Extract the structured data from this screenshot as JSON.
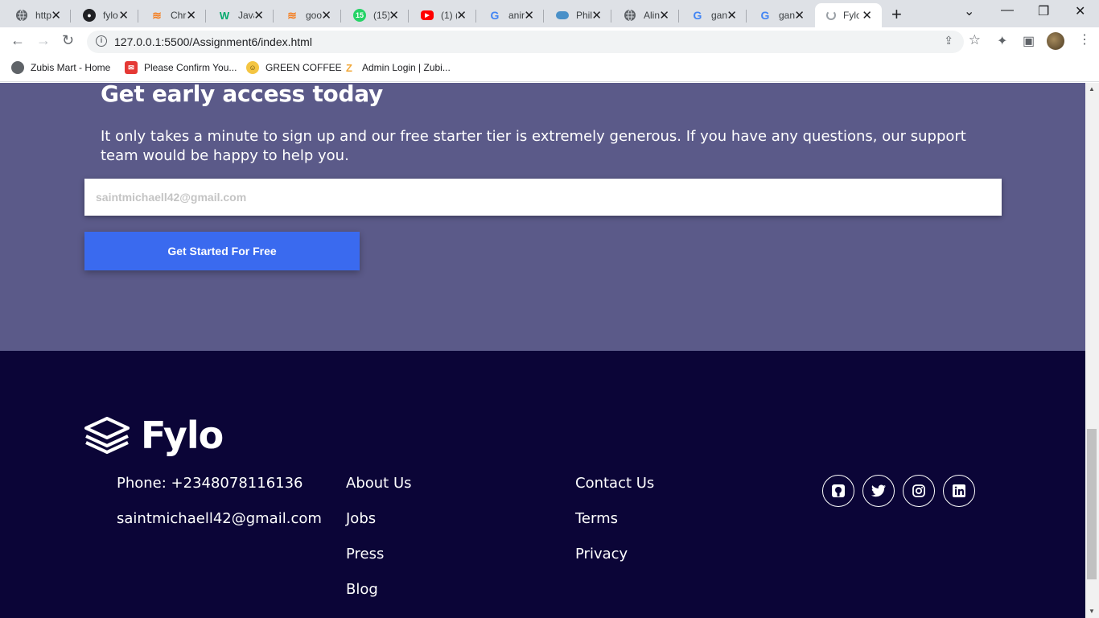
{
  "browser": {
    "tabs": [
      {
        "title": "http",
        "icon": "globe-icon",
        "color": "#5f6368"
      },
      {
        "title": "fylo",
        "icon": "github-icon",
        "color": "#202124"
      },
      {
        "title": "Chr",
        "icon": "stackoverflow-icon",
        "color": "#f48024"
      },
      {
        "title": "Java",
        "icon": "w3schools-icon",
        "color": "#04aa6d"
      },
      {
        "title": "goo",
        "icon": "stackoverflow-icon",
        "color": "#f48024"
      },
      {
        "title": "(15)",
        "icon": "whatsapp-icon",
        "color": "#25d366",
        "badge": "15"
      },
      {
        "title": "(1) (",
        "icon": "youtube-icon",
        "color": "#ff0000"
      },
      {
        "title": "anir",
        "icon": "google-icon",
        "color": "#4285f4"
      },
      {
        "title": "Phil",
        "icon": "cloud-icon",
        "color": "#4a90c8"
      },
      {
        "title": "Alin",
        "icon": "globe-icon",
        "color": "#5f6368"
      },
      {
        "title": "gan",
        "icon": "google-icon",
        "color": "#4285f4"
      },
      {
        "title": "gan",
        "icon": "google-icon",
        "color": "#4285f4"
      },
      {
        "title": "Fylo",
        "icon": "loading-icon",
        "color": "#9aa0a6",
        "active": true
      }
    ],
    "url": "127.0.0.1:5500/Assignment6/index.html",
    "bookmarks": [
      {
        "label": "Zubis Mart - Home",
        "icon": "globe-icon",
        "color": "#5f6368"
      },
      {
        "label": "Please Confirm You...",
        "icon": "mail-icon",
        "color": "#e53935"
      },
      {
        "label": "GREEN COFFEE",
        "icon": "smiley-icon",
        "color": "#f4c542"
      },
      {
        "label": "Admin Login | Zubi...",
        "icon": "zubis-icon",
        "color": "#f2a93b"
      }
    ]
  },
  "signup": {
    "heading": "Get early access today",
    "body": "It only takes a minute to sign up and our free starter tier is extremely generous. If you have any questions, our support team would be happy to help you.",
    "email_placeholder": "saintmichaell42@gmail.com",
    "button_label": "Get Started For Free"
  },
  "footer": {
    "brand": "Fylo",
    "contact": {
      "phone": "Phone: +2348078116136",
      "email": "saintmichaell42@gmail.com"
    },
    "links_col1": [
      "About Us",
      "Jobs",
      "Press",
      "Blog"
    ],
    "links_col2": [
      "Contact Us",
      "Terms",
      "Privacy"
    ],
    "socials": [
      "github-icon",
      "twitter-icon",
      "instagram-icon",
      "linkedin-icon"
    ]
  },
  "colors": {
    "signup_bg": "#5b5a89",
    "footer_bg": "#0b0537",
    "button": "#3a6aef"
  }
}
